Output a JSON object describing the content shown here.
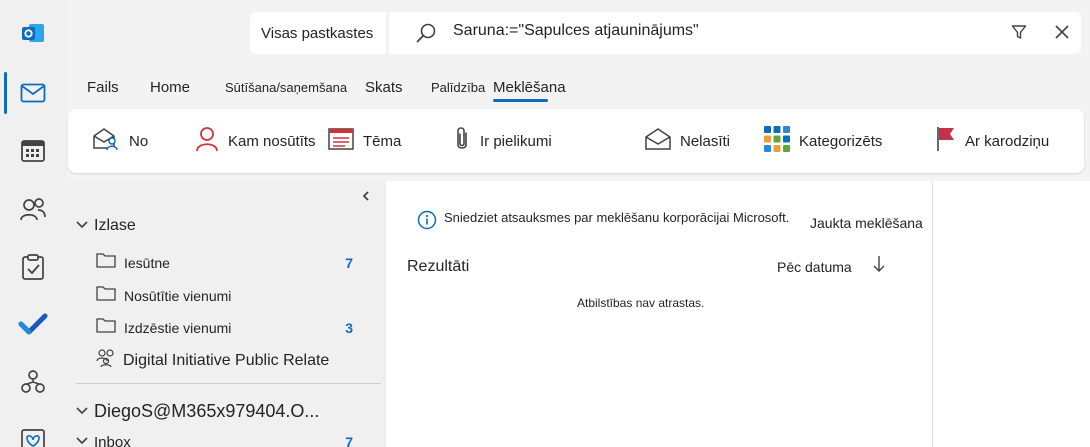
{
  "search": {
    "scope_label": "Visas pastkastes",
    "query": "Saruna:=\"Sapulces atjauninājums\""
  },
  "tabs": [
    {
      "label": "Fails"
    },
    {
      "label": "Home"
    },
    {
      "label": "Sūtīšana/saņemšana"
    },
    {
      "label": "Skats"
    },
    {
      "label": "Palīdzība"
    },
    {
      "label": "Meklēšana"
    }
  ],
  "active_tab": "Meklēšana",
  "ribbon": {
    "from": "No",
    "to": "Kam nosūtīts",
    "subject": "Tēma",
    "attachments": "Ir pielikumi",
    "unread": "Nelasīti",
    "categorized": "Kategorizēts",
    "flagged": "Ar karodziņu"
  },
  "folders": {
    "favorites_title": "Izlase",
    "favorites": [
      {
        "label": "Iesūtne",
        "count": "7"
      },
      {
        "label": "Nosūtītie vienumi",
        "count": ""
      },
      {
        "label": "Izdzēstie vienumi",
        "count": "3"
      }
    ],
    "group_label": "Digital Initiative Public Relate",
    "account_title": "DiegoS@M365x979404.O...",
    "account_inbox": {
      "label": "Inbox",
      "count": "7"
    }
  },
  "messages": {
    "feedback_text": "Sniedziet atsauksmes par meklēšanu korporācijai Microsoft.",
    "advanced_search": "Jaukta meklēšana",
    "results_label": "Rezultāti",
    "sort_label": "Pēc datuma",
    "empty_text": "Atbilstības nav atrastas."
  },
  "colors": {
    "accent": "#0f6cbd",
    "flag": "#c4314b",
    "person_icon": "#d13438"
  }
}
